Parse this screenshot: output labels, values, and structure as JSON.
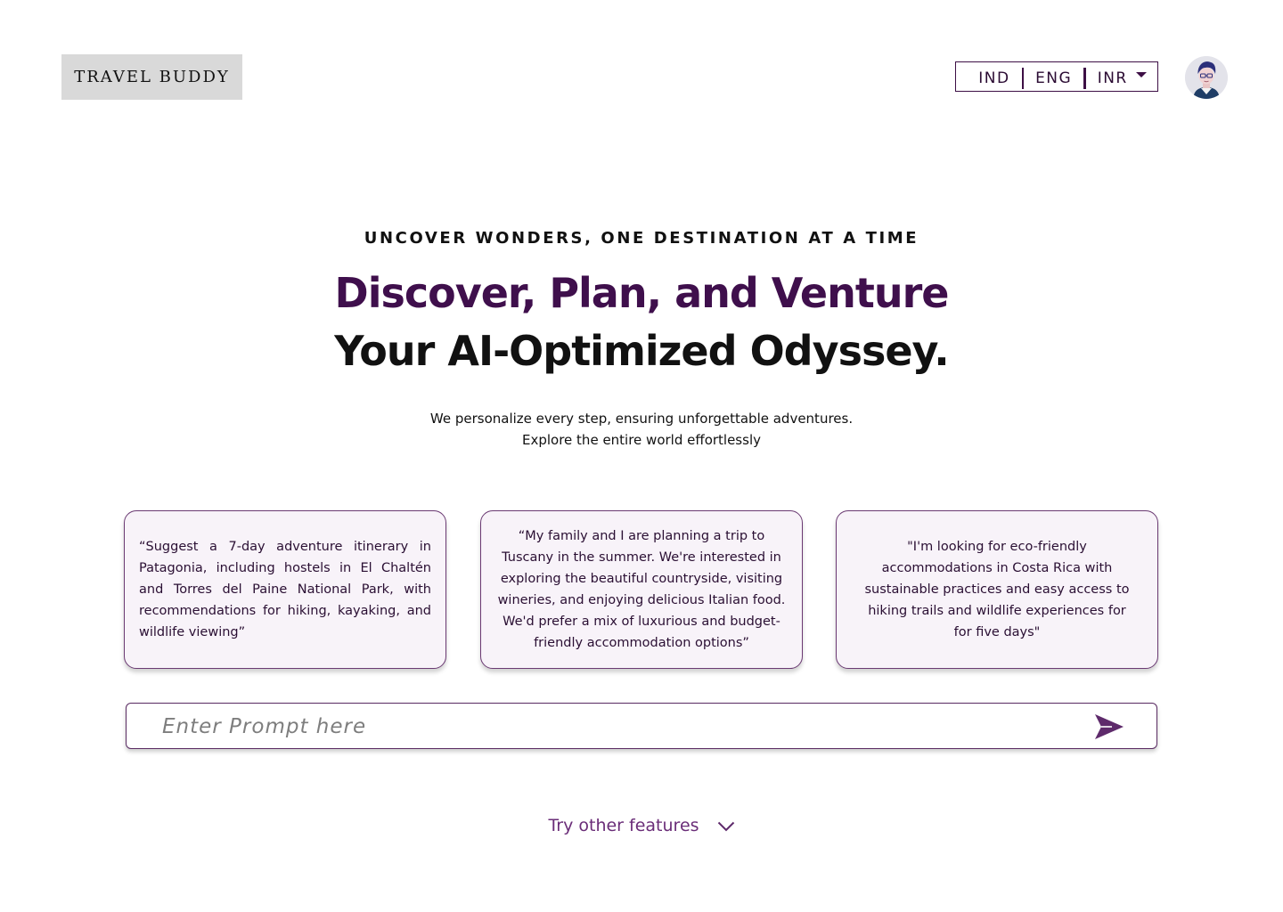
{
  "header": {
    "logo_text": "TRAVEL BUDDY",
    "locale": {
      "country": "IND",
      "language": "ENG",
      "currency": "INR"
    },
    "avatar_icon": "user-avatar-icon"
  },
  "hero": {
    "eyebrow": "UNCOVER WONDERS, ONE DESTINATION AT A TIME",
    "headline_line1": "Discover, Plan, and Venture",
    "headline_line2": "Your AI-Optimized Odyssey.",
    "subtitle_line1": "We personalize every step, ensuring unforgettable adventures.",
    "subtitle_line2": "Explore the entire world effortlessly"
  },
  "suggestions": [
    {
      "text": "“Suggest a 7-day adventure itinerary in Patagonia, including hostels in El Chaltén and Torres del Paine National Park, with recommendations for hiking, kayaking, and wildlife viewing”"
    },
    {
      "text": "“My family and I are planning a trip to Tuscany in the summer. We're interested in exploring the beautiful countryside, visiting wineries, and enjoying delicious Italian food. We'd prefer a mix of luxurious and budget-friendly accommodation options”"
    },
    {
      "text": "\"I'm looking for eco-friendly accommodations in Costa Rica with sustainable practices and easy access to hiking trails and wildlife experiences for for five days\""
    }
  ],
  "prompt": {
    "placeholder": "Enter Prompt here",
    "value": "",
    "send_icon": "send-icon"
  },
  "footer": {
    "features_label": "Try other features",
    "chevron_icon": "chevron-down-icon"
  },
  "colors": {
    "brand_purple": "#3f0f4c",
    "accent_purple": "#6a2d78",
    "card_bg": "#f8f3f9",
    "logo_bg": "#d9d9d9"
  }
}
